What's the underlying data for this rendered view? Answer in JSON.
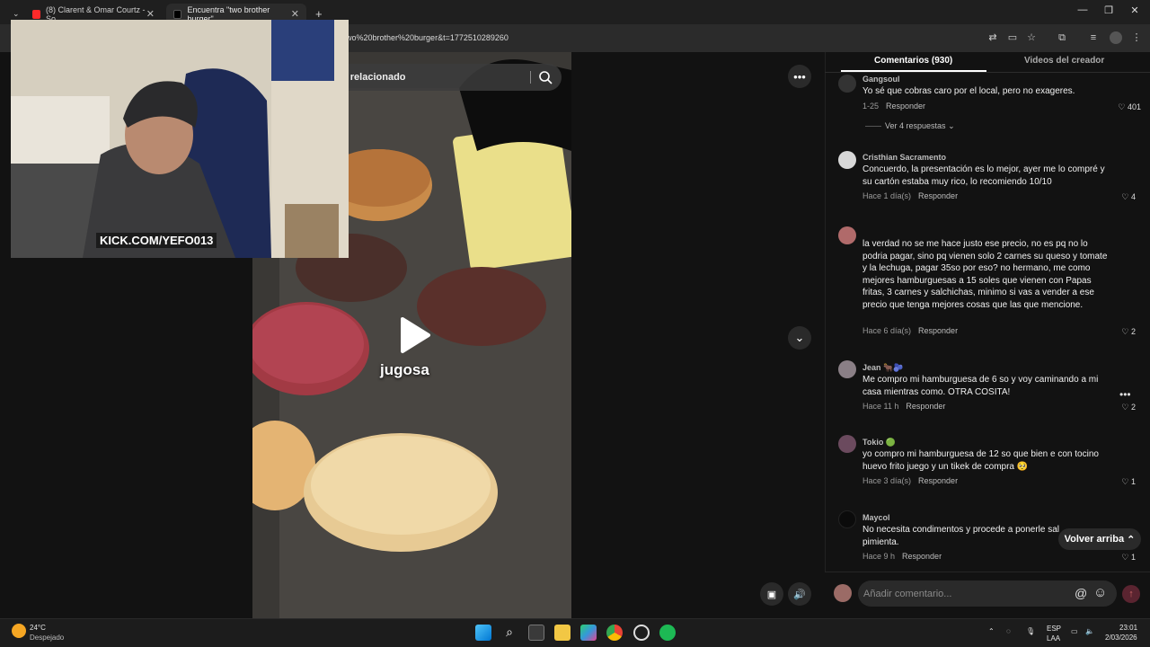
{
  "browser": {
    "tabs": [
      {
        "label": "(8) Clarent & Omar Courtz - So",
        "fav_color": "#ff2a2a"
      },
      {
        "label": "Encuentra \"two brother burger\"",
        "fav_color": "#111111"
      }
    ],
    "url": "wo%20brother%20burger&t=1772510289260"
  },
  "webcam": {
    "banner": "KICK.COM/YEFO013"
  },
  "video": {
    "search_text": "o relacionado",
    "caption": "jugosa"
  },
  "panel": {
    "tab_comments": "Comentarios (930)",
    "tab_creator": "Videos del creador",
    "view_replies": "Ver 4 respuestas",
    "back_to_top": "Volver arriba",
    "add_comment_placeholder": "Añadir comentario...",
    "comments": [
      {
        "user": "Gangsoul",
        "text": "Yo sé que cobras caro por el local, pero no exageres.",
        "time": "1-25",
        "reply": "Responder",
        "likes": "401",
        "avatar": "#333333"
      },
      {
        "user": "Cristhian Sacramento",
        "text": "Concuerdo, la presentación es lo mejor, ayer me lo compré y su cartón estaba muy rico, lo recomiendo 10/10",
        "time": "Hace 1 día(s)",
        "reply": "Responder",
        "likes": "4",
        "avatar": "#d8d8d8"
      },
      {
        "user": "",
        "text": "la verdad no se me hace justo ese precio, no es pq no lo podria pagar, sino pq vienen solo 2 carnes su queso y tomate y la lechuga, pagar 35so por eso? no hermano, me como mejores hamburguesas a 15 soles que vienen con Papas fritas, 3 carnes y salchichas, minimo si vas a vender a ese precio que tenga mejores cosas que las que mencione.",
        "time": "Hace 6 día(s)",
        "reply": "Responder",
        "likes": "2",
        "avatar": "#b06a6a"
      },
      {
        "user": "Jean 🐂🫐",
        "text": "Me compro mi hamburguesa de 6 so y voy caminando a mi casa mientras como. OTRA COSITA!",
        "time": "Hace 11 h",
        "reply": "Responder",
        "likes": "2",
        "avatar": "#8a7f86"
      },
      {
        "user": "Tokio 🟢",
        "text": "yo compro mi hamburguesa de 12 so que bien e con tocino huevo frito juego y un tikek de compra 🥺",
        "time": "Hace 3 día(s)",
        "reply": "Responder",
        "likes": "1",
        "avatar": "#6b4a5e"
      },
      {
        "user": "Maycol",
        "text": "No necesita condimentos y procede a ponerle sal pimienta.",
        "time": "Hace 9 h",
        "reply": "Responder",
        "likes": "1",
        "avatar": "#0b0b0b"
      }
    ]
  },
  "taskbar": {
    "weather_temp": "24°C",
    "weather_desc": "Despejado",
    "lang_top": "ESP",
    "lang_bottom": "LAA",
    "time": "23:01",
    "date": "2/03/2026"
  }
}
